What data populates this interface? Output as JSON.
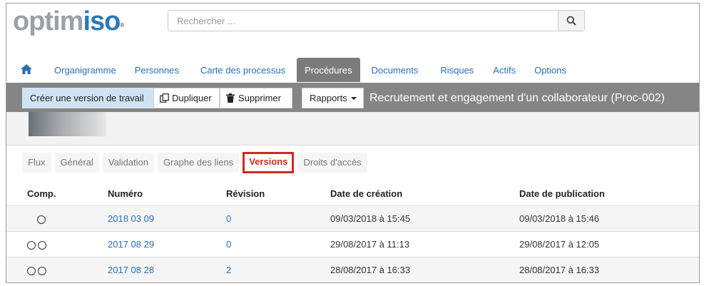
{
  "header": {
    "logo_part1": "optim",
    "logo_part2": "iso",
    "logo_reg": "®",
    "search": {
      "placeholder": "Rechercher ..."
    }
  },
  "nav": {
    "items": [
      {
        "label": "Organigramme"
      },
      {
        "label": "Personnes"
      },
      {
        "label": "Carte des processus"
      },
      {
        "label": "Procédures",
        "active": true
      },
      {
        "label": "Documents"
      },
      {
        "label": "Risques"
      },
      {
        "label": "Actifs"
      },
      {
        "label": "Options"
      }
    ]
  },
  "toolbar": {
    "create_version_label": "Créer une version de travail",
    "duplicate_label": "Dupliquer",
    "delete_label": "Supprimer",
    "reports_label": "Rapports",
    "title": "Recrutement et engagement d'un collaborateur (Proc-002)"
  },
  "tabs": [
    {
      "label": "Flux"
    },
    {
      "label": "Général"
    },
    {
      "label": "Validation"
    },
    {
      "label": "Graphe des liens"
    },
    {
      "label": "Versions",
      "active": true
    },
    {
      "label": "Droits d'accès"
    }
  ],
  "table": {
    "headers": [
      "Comp.",
      "Numéro",
      "Révision",
      "Date de création",
      "Date de publication"
    ],
    "rows": [
      {
        "radios": 1,
        "numero": "2018 03 09",
        "revision": "0",
        "creation": "09/03/2018 à 15:45",
        "publication": "09/03/2018 à 15:46"
      },
      {
        "radios": 2,
        "numero": "2017 08 29",
        "revision": "0",
        "creation": "29/08/2017 à 11:13",
        "publication": "29/08/2017 à 12:05"
      },
      {
        "radios": 2,
        "numero": "2017 08 28",
        "revision": "2",
        "creation": "28/08/2017 à 16:33",
        "publication": "28/08/2017 à 16:33"
      }
    ]
  },
  "colors": {
    "accent": "#2a6fb3",
    "toolbar": "#858585",
    "active_tab": "#d3281e"
  }
}
